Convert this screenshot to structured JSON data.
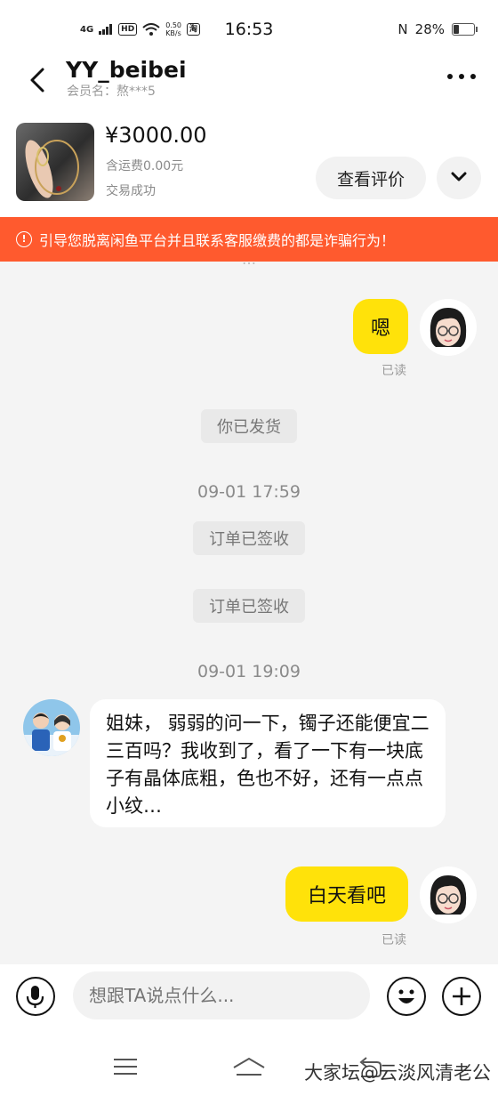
{
  "status_bar": {
    "network": "4G",
    "hd": "HD",
    "speed_value": "0.50",
    "speed_unit": "KB/s",
    "app_badge": "淘",
    "time": "16:53",
    "nfc": "N",
    "battery": "28%"
  },
  "header": {
    "title": "YY_beibei",
    "member": "会员名：熬***5"
  },
  "product": {
    "price": "¥3000.00",
    "shipping": "含运费0.00元",
    "status": "交易成功",
    "review_button": "查看评价"
  },
  "warning": {
    "icon": "!",
    "text": "引导您脱离闲鱼平台并且联系客服缴费的都是诈骗行为！"
  },
  "chat": {
    "clipped_top": "…",
    "msg1": {
      "text": "嗯",
      "read": "已读"
    },
    "sys_shipped": "你已发货",
    "time1": "09-01 17:59",
    "sys_received_1": "订单已签收",
    "sys_received_2": "订单已签收",
    "time2": "09-01 19:09",
    "msg2": {
      "text": "姐妹， 弱弱的问一下，镯子还能便宜二三百吗？我收到了，看了一下有一块底子有晶体底粗，色也不好，还有一点点小纹…"
    },
    "msg3": {
      "text": "白天看吧",
      "read": "已读"
    }
  },
  "input": {
    "placeholder": "想跟TA说点什么..."
  },
  "watermark": "大家坛@云淡风清老公",
  "colors": {
    "accent_yellow": "#ffe20a",
    "warning_orange": "#ff5a2e"
  }
}
